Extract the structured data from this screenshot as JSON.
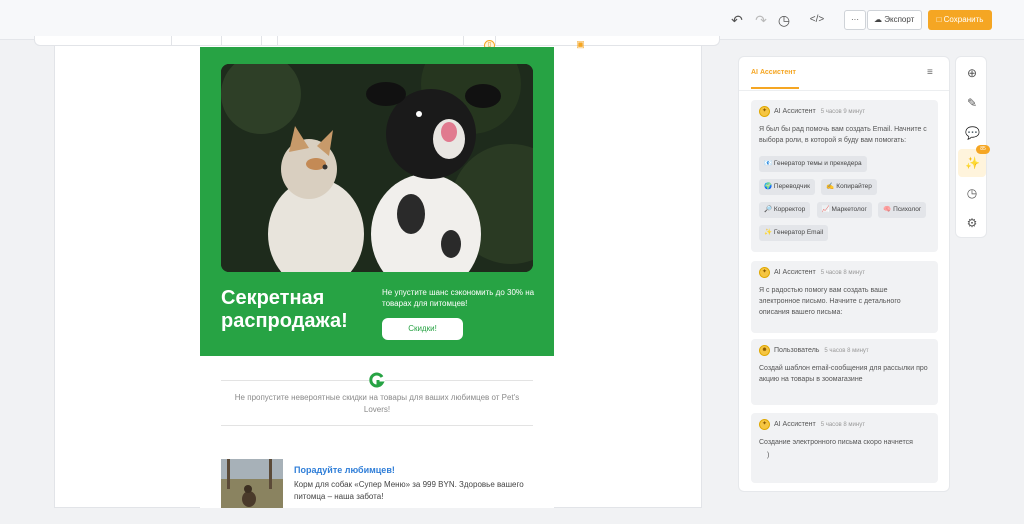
{
  "toolbar": {
    "undo_icon": "undo-icon",
    "redo_icon": "redo-icon",
    "history_icon": "history-icon",
    "code_icon": "code-icon",
    "more_label": "···",
    "export_label": "Экспорт",
    "save_label": "Сохранить",
    "accent": "#f5a623"
  },
  "email": {
    "hero_color": "#27a344",
    "hero_title": "Секретная распродажа!",
    "hero_text": "Не упустите шанс сэкономить до 30% на товарах для питомцев!",
    "hero_button": "Скидки!",
    "promo_text": "Не пропустите невероятные скидки на товары для ваших любимцев от Pet's Lovers!",
    "product_title": "Порадуйте любимцев!",
    "product_text": "Корм для собак «Супер Меню» за 999 BYN. Здоровье вашего питомца – наша забота!"
  },
  "panel": {
    "tab_label": "AI Ассистент",
    "messages": [
      {
        "author": "AI Ассистент",
        "time": "5 часов 9 минут",
        "text": "Я был бы рад помочь вам создать Email. Начните с выбора роли, в которой я буду вам помогать:",
        "chips": [
          "📧 Генератор темы и прехедера",
          "🌍 Переводчик",
          "✍️ Копирайтер",
          "🔎 Корректор",
          "📈 Маркетолог",
          "🧠 Психолог",
          "✨ Генератор Email"
        ]
      },
      {
        "author": "AI Ассистент",
        "time": "5 часов 8 минут",
        "text": "Я с радостью помогу вам создать ваше электронное письмо. Начните с детального описания вашего письма:"
      },
      {
        "author": "Пользователь",
        "time": "5 часов 8 минут",
        "text": "Создай шаблон email-сообщения для рассылки про акцию на товары в зоомагазине"
      },
      {
        "author": "AI Ассистент",
        "time": "5 часов 8 минут",
        "text": "Создание электронного письма скоро начнется",
        "extra": ")"
      }
    ]
  },
  "rail": {
    "icons": [
      "plus-icon",
      "brush-icon",
      "chat-icon",
      "sparkle-icon",
      "gauge-icon",
      "gear-icon"
    ],
    "badge": "85"
  }
}
